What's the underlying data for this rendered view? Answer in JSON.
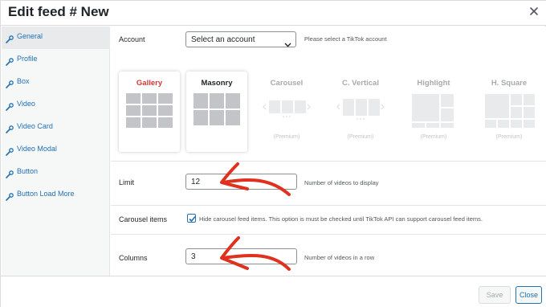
{
  "dialog": {
    "title": "Edit feed # New"
  },
  "sidebar": {
    "items": [
      {
        "label": "General"
      },
      {
        "label": "Profile"
      },
      {
        "label": "Box"
      },
      {
        "label": "Video"
      },
      {
        "label": "Video Card"
      },
      {
        "label": "Video Modal"
      },
      {
        "label": "Button"
      },
      {
        "label": "Button Load More"
      }
    ]
  },
  "account": {
    "label": "Account",
    "selected": "Select an account",
    "hint": "Please select a TikTok account"
  },
  "layouts": [
    {
      "name": "Gallery",
      "premium": ""
    },
    {
      "name": "Masonry",
      "premium": ""
    },
    {
      "name": "Carousel",
      "premium": "(Premium)"
    },
    {
      "name": "C. Vertical",
      "premium": "(Premium)"
    },
    {
      "name": "Highlight",
      "premium": "(Premium)"
    },
    {
      "name": "H. Square",
      "premium": "(Premium)"
    }
  ],
  "limit": {
    "label": "Limit",
    "value": "12",
    "desc": "Number of videos to display"
  },
  "carousel_items": {
    "label": "Carousel items",
    "checked": true,
    "desc": "Hide carousel feed items. This option is must be checked until TikTok API can support carousel feed items."
  },
  "columns": {
    "label": "Columns",
    "value": "3",
    "desc": "Number of videos in a row"
  },
  "footer": {
    "save_label": "Save",
    "close_label": "Close"
  },
  "colors": {
    "accent": "#2271b1",
    "gallery_active": "#d63638",
    "annotation_arrow": "#e0301e",
    "tile_active": "#c3c4c7",
    "tile_premium": "#e9eaeb"
  }
}
